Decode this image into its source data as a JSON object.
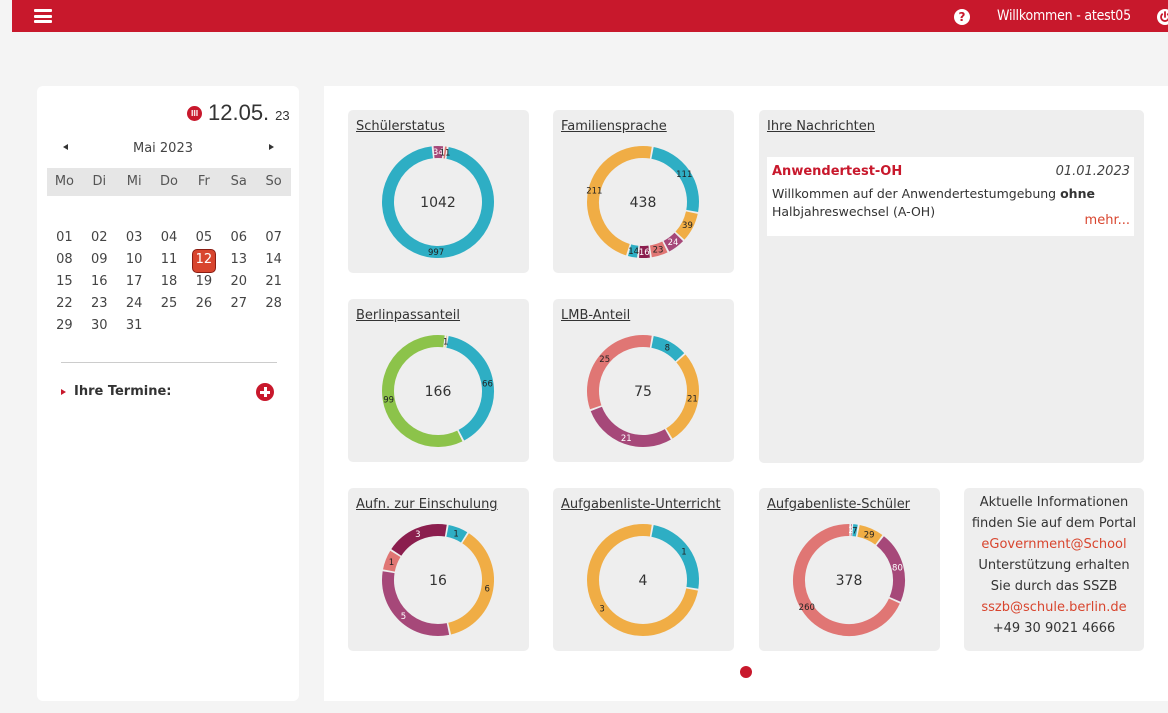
{
  "header": {
    "welcome": "Willkommen - atest05",
    "menu_icon": "hamburger-icon",
    "help_icon": "question-circle-icon",
    "help_glyph": "?",
    "power_icon": "power-icon",
    "bar_color": "#c8182c"
  },
  "calendar": {
    "day_month": "12.05.",
    "year": "23",
    "month": "Mai 2023",
    "weekdays": [
      "Mo",
      "Di",
      "Mi",
      "Do",
      "Fr",
      "Sa",
      "So"
    ],
    "weeks": [
      [
        "01",
        "02",
        "03",
        "04",
        "05",
        "06",
        "07"
      ],
      [
        "08",
        "09",
        "10",
        "11",
        "12",
        "13",
        "14"
      ],
      [
        "15",
        "16",
        "17",
        "18",
        "19",
        "20",
        "21"
      ],
      [
        "22",
        "23",
        "24",
        "25",
        "26",
        "27",
        "28"
      ],
      [
        "29",
        "30",
        "31",
        "",
        "",
        "",
        ""
      ]
    ],
    "today": "12",
    "termine_label": "Ihre Termine:"
  },
  "widgets": [
    {
      "title": "Schülerstatus",
      "total": "1042",
      "segments": [
        {
          "value": 997,
          "label": "997",
          "color": "#2eaec4"
        },
        {
          "value": 34,
          "label": "34",
          "color": "#a64879"
        },
        {
          "value": 11,
          "label": "11",
          "color": "#e07674"
        }
      ]
    },
    {
      "title": "Familiensprache",
      "total": "438",
      "segments": [
        {
          "value": 111,
          "label": "111",
          "color": "#2eaec4"
        },
        {
          "value": 39,
          "label": "39",
          "color": "#f0ad45"
        },
        {
          "value": 24,
          "label": "24",
          "color": "#a64879"
        },
        {
          "value": 23,
          "label": "23",
          "color": "#e07674"
        },
        {
          "value": 16,
          "label": "16",
          "color": "#8b1e4e"
        },
        {
          "value": 14,
          "label": "14",
          "color": "#2eaec4"
        },
        {
          "value": 211,
          "label": "211",
          "color": "#f0ad45"
        }
      ]
    },
    {
      "title": "Berlinpassanteil",
      "total": "166",
      "segments": [
        {
          "value": 66,
          "label": "66",
          "color": "#2eaec4"
        },
        {
          "value": 99,
          "label": "99",
          "color": "#8cc34a"
        },
        {
          "value": 1,
          "label": "1",
          "color": "#f0ad45"
        }
      ]
    },
    {
      "title": "LMB-Anteil",
      "total": "75",
      "segments": [
        {
          "value": 8,
          "label": "8",
          "color": "#2eaec4"
        },
        {
          "value": 21,
          "label": "21",
          "color": "#f0ad45"
        },
        {
          "value": 21,
          "label": "21",
          "color": "#a64879"
        },
        {
          "value": 25,
          "label": "25",
          "color": "#e07674"
        }
      ]
    },
    {
      "title": "Aufn. zur Einschulung",
      "total": "16",
      "segments": [
        {
          "value": 1,
          "label": "1",
          "color": "#2eaec4"
        },
        {
          "value": 6,
          "label": "6",
          "color": "#f0ad45"
        },
        {
          "value": 5,
          "label": "5",
          "color": "#a64879"
        },
        {
          "value": 1,
          "label": "1",
          "color": "#e07674"
        },
        {
          "value": 3,
          "label": "3",
          "color": "#8b1e4e"
        }
      ]
    },
    {
      "title": "Aufgabenliste-Unterricht",
      "total": "4",
      "segments": [
        {
          "value": 1,
          "label": "1",
          "color": "#2eaec4"
        },
        {
          "value": 3,
          "label": "3",
          "color": "#f0ad45"
        }
      ]
    },
    {
      "title": "Aufgabenliste-Schüler",
      "total": "378",
      "segments": [
        {
          "value": 29,
          "label": "29",
          "color": "#f0ad45"
        },
        {
          "value": 80,
          "label": "80",
          "color": "#a64879"
        },
        {
          "value": 260,
          "label": "260",
          "color": "#e07674"
        },
        {
          "value": 2,
          "label": "2",
          "color": "#8b1e4e"
        },
        {
          "value": 7,
          "label": "7",
          "color": "#2eaec4"
        }
      ]
    }
  ],
  "messages": {
    "title": "Ihre Nachrichten",
    "item": {
      "title": "Anwendertest-OH",
      "date": "01.01.2023",
      "body_pre": "Willkommen auf der Anwendertestumgebung ",
      "body_bold": "ohne",
      "body_post": " Halbjahreswechsel (A-OH)",
      "more": "mehr..."
    }
  },
  "info": {
    "line1": "Aktuelle Informationen",
    "line2": "finden Sie auf dem Portal",
    "link1": "eGovernment@School",
    "line3": "Unterstützung erhalten",
    "line4": "Sie durch das SSZB",
    "link2": "sszb@schule.berlin.de",
    "phone": "+49 30 9021 4666"
  }
}
